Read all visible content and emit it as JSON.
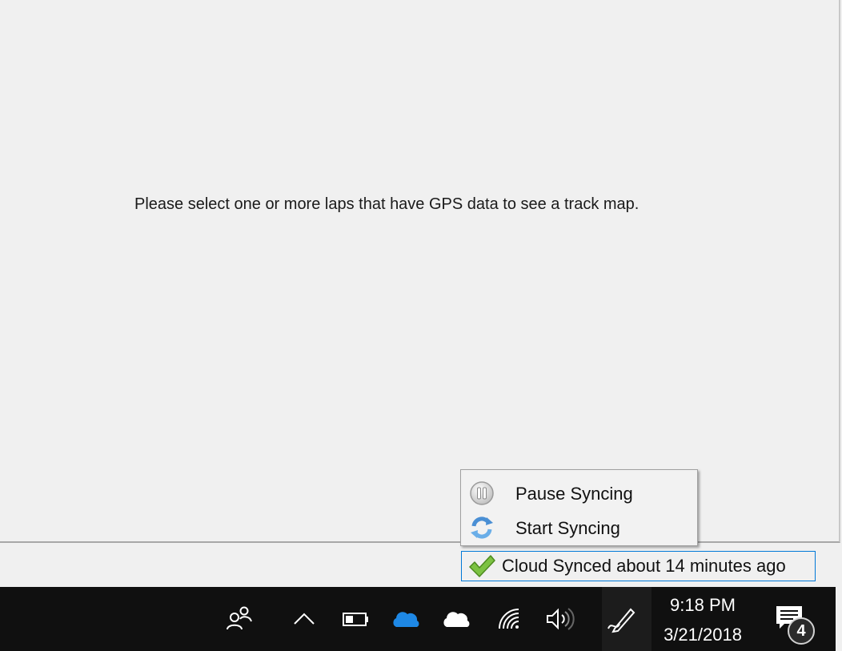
{
  "map_panel": {
    "message": "Please select one or more laps that have GPS data to see a track map."
  },
  "context_menu": {
    "items": [
      {
        "label": "Pause Syncing",
        "icon": "pause-icon"
      },
      {
        "label": "Start Syncing",
        "icon": "sync-arrows-icon"
      }
    ]
  },
  "sync_status": {
    "label": "Cloud Synced about 14 minutes ago",
    "icon": "check-icon",
    "accent_color": "#0078d7",
    "check_color": "#7cc242"
  },
  "taskbar": {
    "icons": [
      "people-icon",
      "chevron-up-icon",
      "battery-icon",
      "onedrive-icon",
      "cloud-icon",
      "wifi-icon",
      "volume-icon",
      "pen-icon"
    ],
    "clock": {
      "time": "9:18 PM",
      "date": "3/21/2018"
    },
    "notifications": {
      "count": "4",
      "icon": "action-center-icon"
    },
    "background_color": "#101010"
  }
}
